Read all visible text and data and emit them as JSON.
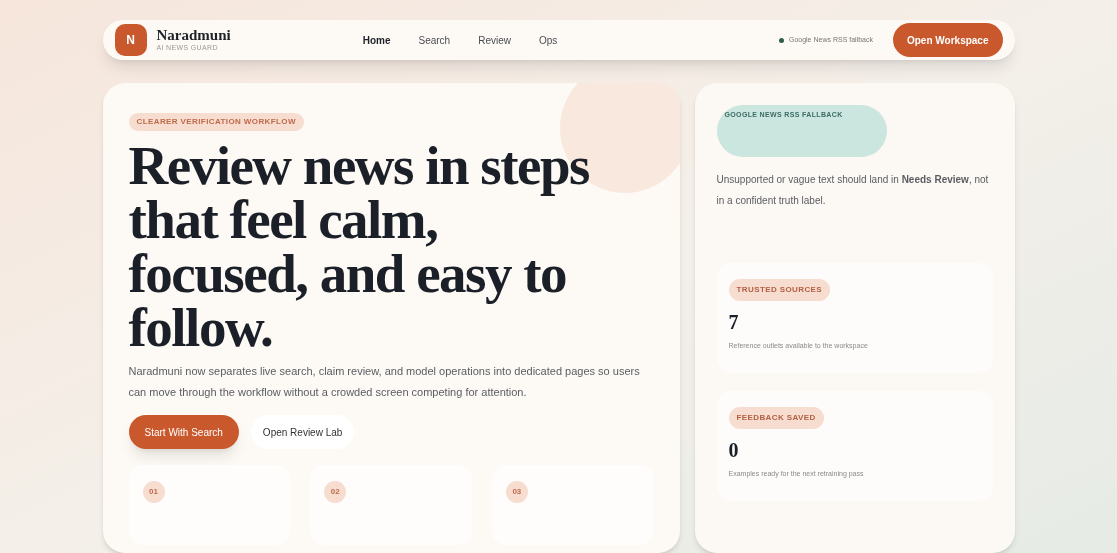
{
  "brand": {
    "logo_letter": "N",
    "name": "Naradmuni",
    "tagline": "AI NEWS GUARD"
  },
  "nav": [
    {
      "label": "Home",
      "selected": true
    },
    {
      "label": "Search",
      "selected": false
    },
    {
      "label": "Review",
      "selected": false
    },
    {
      "label": "Ops",
      "selected": false
    }
  ],
  "status": {
    "label": "Google News RSS fallback",
    "color": "#2f5d50"
  },
  "workspace_button": "Open Workspace",
  "hero": {
    "badge": "CLEARER VERIFICATION WORKFLOW",
    "headline": "Review news in steps that feel calm, focused, and easy to follow.",
    "body": "Naradmuni now separates live search, claim review, and model operations into dedicated pages so users can move through the workflow without a crowded screen competing for attention.",
    "primary_button": "Start With Search",
    "secondary_button": "Open Review Lab"
  },
  "steps": [
    {
      "number": "01"
    },
    {
      "number": "02"
    },
    {
      "number": "03"
    }
  ],
  "source_panel": {
    "badge": "GOOGLE NEWS RSS FALLBACK",
    "note": "Unsupported or vague text should land in **Needs Review**, not in a confident truth label."
  },
  "stats": [
    {
      "label": "TRUSTED SOURCES",
      "value": "7",
      "caption": "Reference outlets available to the workspace"
    },
    {
      "label": "FEEDBACK SAVED",
      "value": "0",
      "caption": "Examples ready for the next retraining pass"
    }
  ]
}
